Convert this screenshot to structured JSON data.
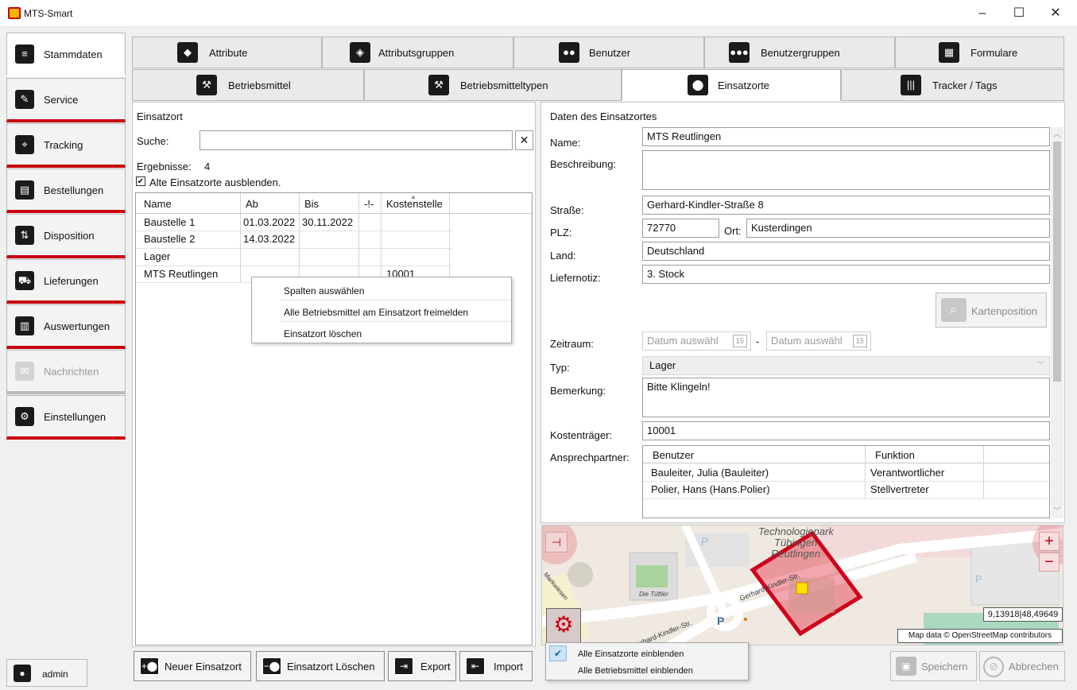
{
  "app": {
    "title": "MTS-Smart"
  },
  "window": {
    "minimize": "–",
    "maximize": "☐",
    "close": "✕"
  },
  "sidebar": {
    "items": [
      {
        "label": "Stammdaten",
        "icon": "list-icon"
      },
      {
        "label": "Service",
        "icon": "wrench-icon"
      },
      {
        "label": "Tracking",
        "icon": "tracking-icon"
      },
      {
        "label": "Bestellungen",
        "icon": "order-icon"
      },
      {
        "label": "Disposition",
        "icon": "disposition-icon"
      },
      {
        "label": "Lieferungen",
        "icon": "truck-icon"
      },
      {
        "label": "Auswertungen",
        "icon": "chart-icon"
      },
      {
        "label": "Nachrichten",
        "icon": "mail-icon"
      },
      {
        "label": "Einstellungen",
        "icon": "gear-icon"
      }
    ],
    "user": "admin"
  },
  "tabs": {
    "row1": [
      "Attribute",
      "Attributsgruppen",
      "Benutzer",
      "Benutzergruppen",
      "Formulare"
    ],
    "row2": [
      "Betriebsmittel",
      "Betriebsmitteltypen",
      "Einsatzorte",
      "Tracker / Tags"
    ]
  },
  "left": {
    "title": "Einsatzort",
    "search_label": "Suche:",
    "search_value": "",
    "clear": "✕",
    "results_label": "Ergebnisse:",
    "results_count": "4",
    "hide_old_checked": "✔",
    "hide_old_label": "Alte Einsatzorte ausblenden.",
    "columns": [
      "Name",
      "Ab",
      "Bis",
      "-!-",
      "Kostenstelle"
    ],
    "rows": [
      [
        "Baustelle 1",
        "01.03.2022",
        "30.11.2022",
        "",
        ""
      ],
      [
        "Baustelle 2",
        "14.03.2022",
        "",
        "",
        ""
      ],
      [
        "Lager",
        "",
        "",
        "",
        ""
      ],
      [
        "MTS Reutlingen",
        "",
        "",
        "",
        "10001"
      ]
    ]
  },
  "context_menu": {
    "items": [
      "Spalten auswählen",
      "Alle Betriebsmittel am Einsatzort freimelden",
      "Einsatzort löschen"
    ]
  },
  "detail": {
    "title": "Daten des Einsatzortes",
    "name_label": "Name:",
    "name": "MTS Reutlingen",
    "desc_label": "Beschreibung:",
    "desc": "",
    "street_label": "Straße:",
    "street": "Gerhard-Kindler-Straße 8",
    "zip_label": "PLZ:",
    "zip": "72770",
    "city_label": "Ort:",
    "city": "Kusterdingen",
    "country_label": "Land:",
    "country": "Deutschland",
    "note_label": "Liefernotiz:",
    "note": "3. Stock",
    "map_pos": "Kartenposition",
    "period_label": "Zeitraum:",
    "date_placeholder": "Datum auswähl",
    "date_icon": "15",
    "dash": "-",
    "type_label": "Typ:",
    "type": "Lager",
    "remark_label": "Bemerkung:",
    "remark": "Bitte Klingeln!",
    "cost_label": "Kostenträger:",
    "cost": "10001",
    "contacts_label": "Ansprechpartner:",
    "contacts_cols": [
      "Benutzer",
      "Funktion"
    ],
    "contacts": [
      [
        "Bauleiter, Julia (Bauleiter)",
        "Verantwortlicher"
      ],
      [
        "Polier, Hans (Hans.Polier)",
        "Stellvertreter"
      ]
    ]
  },
  "map": {
    "labels": [
      "Technologiepark",
      "Tübingen",
      "Reutlingen",
      "Gerhard-Kindler-Str.",
      "Die Tüftler",
      "Markwiesen",
      "Gerhard-Kindler-Str."
    ],
    "coords": "9,13918|48,49649",
    "attribution": "Map data © OpenStreetMap contributors",
    "zoom_in": "+",
    "zoom_out": "−",
    "parking": "P"
  },
  "map_menu": {
    "items": [
      {
        "label": "Alle Einsatzorte einblenden",
        "checked": "✔"
      },
      {
        "label": "Alle Betriebsmittel einblenden",
        "checked": ""
      }
    ]
  },
  "buttons": {
    "new": "Neuer Einsatzort",
    "delete": "Einsatzort Löschen",
    "export": "Export",
    "import": "Import",
    "save": "Speichern",
    "cancel": "Abbrechen"
  },
  "colors": {
    "accent": "#c80010",
    "map_red": "#e0001a"
  }
}
